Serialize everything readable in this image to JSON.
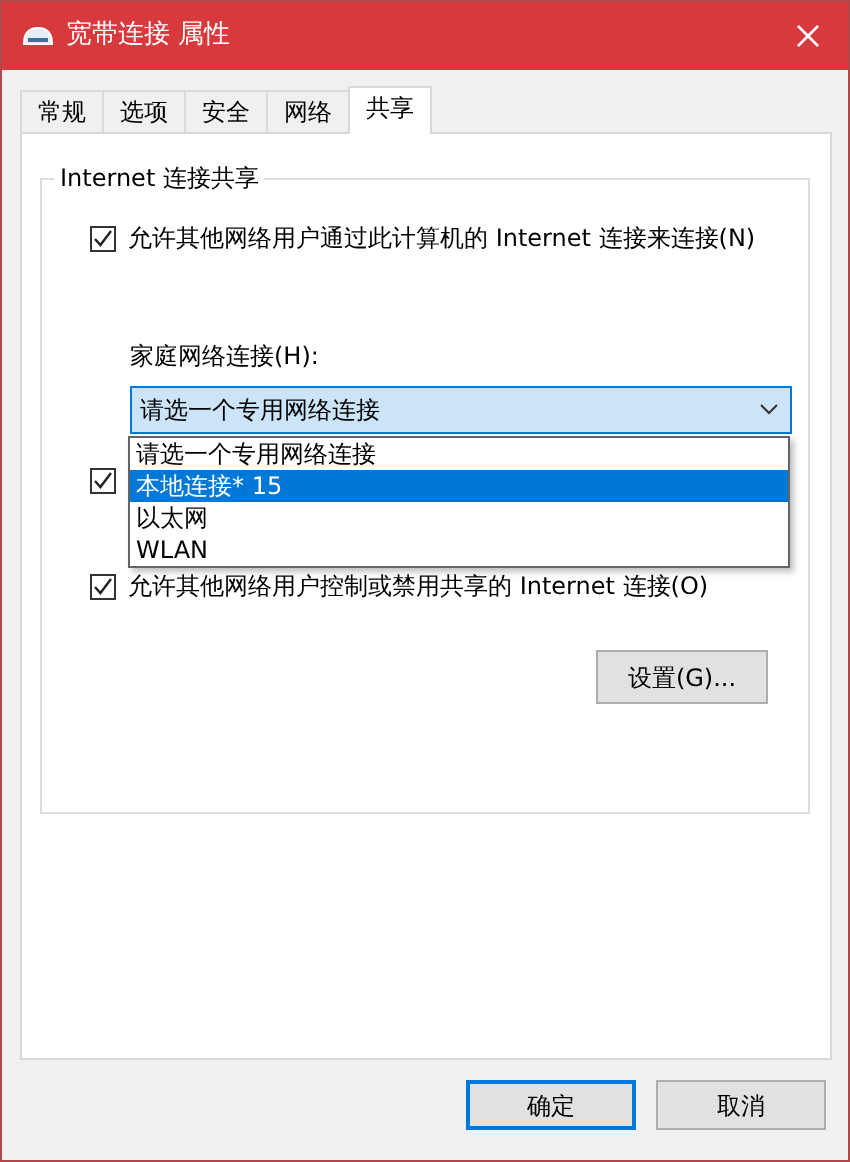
{
  "window": {
    "title": "宽带连接 属性"
  },
  "tabs": [
    {
      "label": "常规",
      "selected": false
    },
    {
      "label": "选项",
      "selected": false
    },
    {
      "label": "安全",
      "selected": false
    },
    {
      "label": "网络",
      "selected": false
    },
    {
      "label": "共享",
      "selected": true
    }
  ],
  "group": {
    "title": "Internet 连接共享"
  },
  "sharing_checkbox": {
    "label": "允许其他网络用户通过此计算机的 Internet 连接来连接(N)",
    "checked": true
  },
  "home_network": {
    "label": "家庭网络连接(H):",
    "value": "请选一个专用网络连接",
    "expanded": true,
    "options": [
      {
        "label": "请选一个专用网络连接",
        "highlighted": false
      },
      {
        "label": "本地连接* 15",
        "highlighted": true
      },
      {
        "label": "以太网",
        "highlighted": false
      },
      {
        "label": "WLAN",
        "highlighted": false
      }
    ]
  },
  "hidden_checkbox": {
    "checked": true
  },
  "control_checkbox": {
    "label": "允许其他网络用户控制或禁用共享的 Internet 连接(O)",
    "checked": true
  },
  "settings_button": "设置(G)...",
  "buttons": [
    {
      "label": "确定",
      "default": true
    },
    {
      "label": "取消",
      "default": false
    }
  ]
}
